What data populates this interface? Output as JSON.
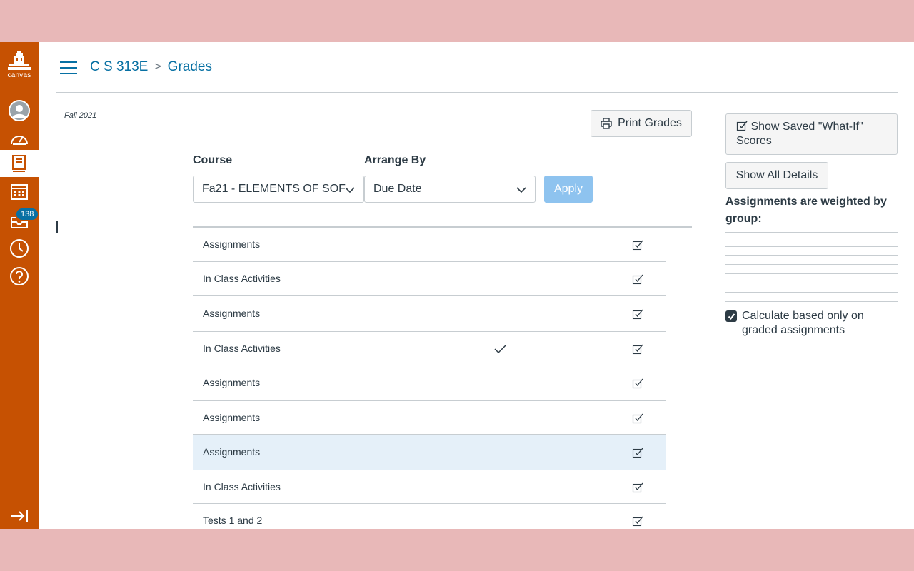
{
  "global_nav": {
    "logo_text": "canvas",
    "inbox_badge": "138",
    "items": [
      "Account",
      "Dashboard",
      "Courses",
      "Calendar",
      "Inbox",
      "History",
      "Help"
    ]
  },
  "header": {
    "course": "C S 313E",
    "separator": ">",
    "page": "Grades"
  },
  "term": "Fall 2021",
  "print_button": "Print Grades",
  "course_select": {
    "label": "Course",
    "value": "Fa21 - ELEMENTS OF SOF"
  },
  "arrange_select": {
    "label": "Arrange By",
    "value": "Due Date"
  },
  "apply_button": "Apply",
  "grades_rows": [
    {
      "name": "Assignments",
      "checked": false
    },
    {
      "name": "In Class Activities",
      "checked": false
    },
    {
      "name": "Assignments",
      "checked": false
    },
    {
      "name": "In Class Activities",
      "checked": true
    },
    {
      "name": "Assignments",
      "checked": false
    },
    {
      "name": "Assignments",
      "checked": false
    },
    {
      "name": "Assignments",
      "checked": false,
      "highlighted": true
    },
    {
      "name": "In Class Activities",
      "checked": false
    },
    {
      "name": "Tests 1 and 2",
      "checked": false
    }
  ],
  "sidebar": {
    "whatif_button": "Show Saved \"What-If\" Scores",
    "details_button": "Show All Details",
    "weighted_heading": "Assignments are weighted by group:",
    "calc_label": "Calculate based only on graded assignments",
    "calc_checked": true
  },
  "colors": {
    "nav_bg": "#c65102",
    "link": "#0770a3",
    "apply_bg": "#8ec3ef",
    "row_highlight": "#e5f0f9"
  }
}
